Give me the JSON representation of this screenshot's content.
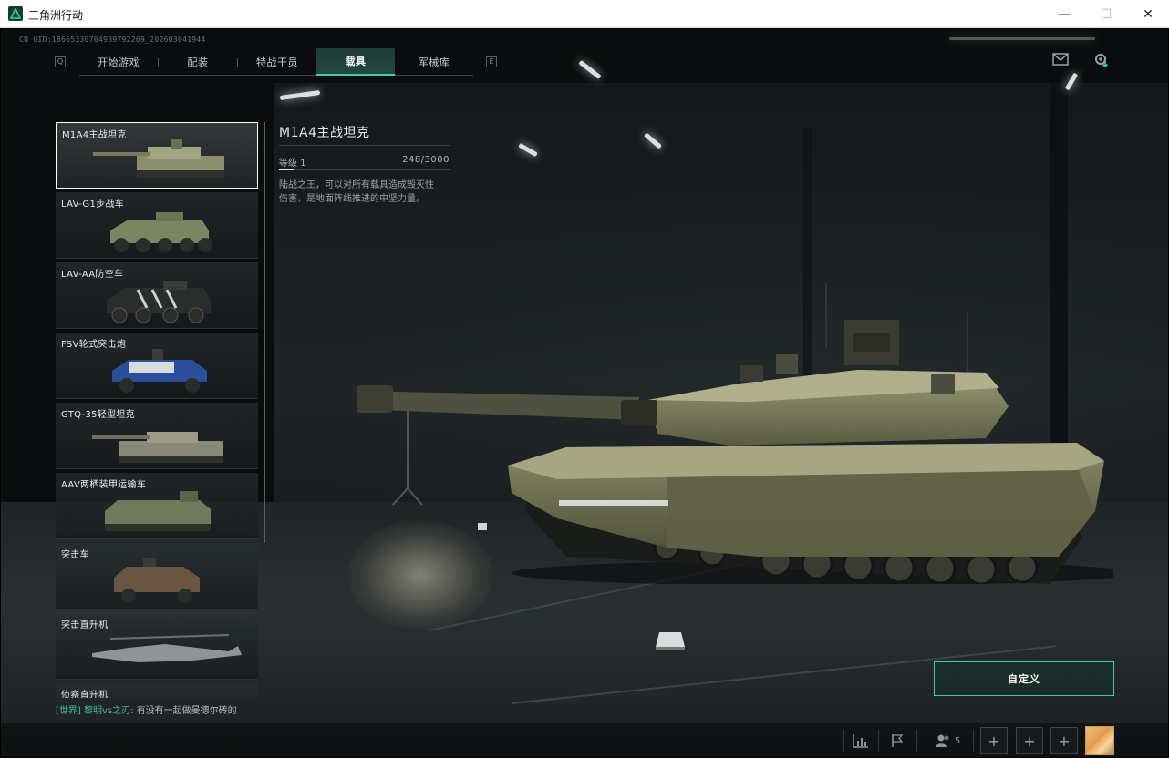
{
  "window": {
    "title": "三角洲行动",
    "min_glyph": "—",
    "max_glyph": "☐",
    "close_glyph": "✕"
  },
  "uid": "CN UID:18665330764989792269_202603041944",
  "nav": {
    "key_left": "Q",
    "key_right": "E",
    "tabs": [
      {
        "label": "开始游戏",
        "active": false
      },
      {
        "label": "配装",
        "active": false
      },
      {
        "label": "特战干员",
        "active": false
      },
      {
        "label": "载具",
        "active": true
      },
      {
        "label": "军械库",
        "active": false
      }
    ]
  },
  "top_icons": {
    "mail": "mail-icon",
    "settings": "gear-download-icon"
  },
  "vehicles": [
    {
      "name": "M1A4主战坦克",
      "selected": true,
      "kind": "tank"
    },
    {
      "name": "LAV-G1步战车",
      "selected": false,
      "kind": "apc"
    },
    {
      "name": "LAV-AA防空车",
      "selected": false,
      "kind": "apc-aa"
    },
    {
      "name": "FSV轮式突击炮",
      "selected": false,
      "kind": "buggy"
    },
    {
      "name": "GTQ-35轻型坦克",
      "selected": false,
      "kind": "light-tank"
    },
    {
      "name": "AAV两栖装甲运输车",
      "selected": false,
      "kind": "amphib"
    },
    {
      "name": "突击车",
      "selected": false,
      "kind": "suv"
    },
    {
      "name": "突击直升机",
      "selected": false,
      "kind": "heli"
    },
    {
      "name": "侦察直升机",
      "selected": false,
      "kind": "heli2"
    }
  ],
  "detail": {
    "name": "M1A4主战坦克",
    "level_label": "等级 1",
    "xp_text": "248/3000",
    "xp_fraction": 0.083,
    "description": "陆战之王，可以对所有载具造成毁灭性伤害，是地面阵线推进的中坚力量。"
  },
  "customize_label": "自定义",
  "chat": {
    "channel": "[世界]",
    "user": "黎明vs之刃:",
    "message": "有没有一起做曼德尔砖的"
  },
  "bottom": {
    "friends_count": "5",
    "plus": "+"
  },
  "colors": {
    "accent": "#3fd1a5",
    "tank_body": "#6d6f4e",
    "background": "#1c2123"
  }
}
